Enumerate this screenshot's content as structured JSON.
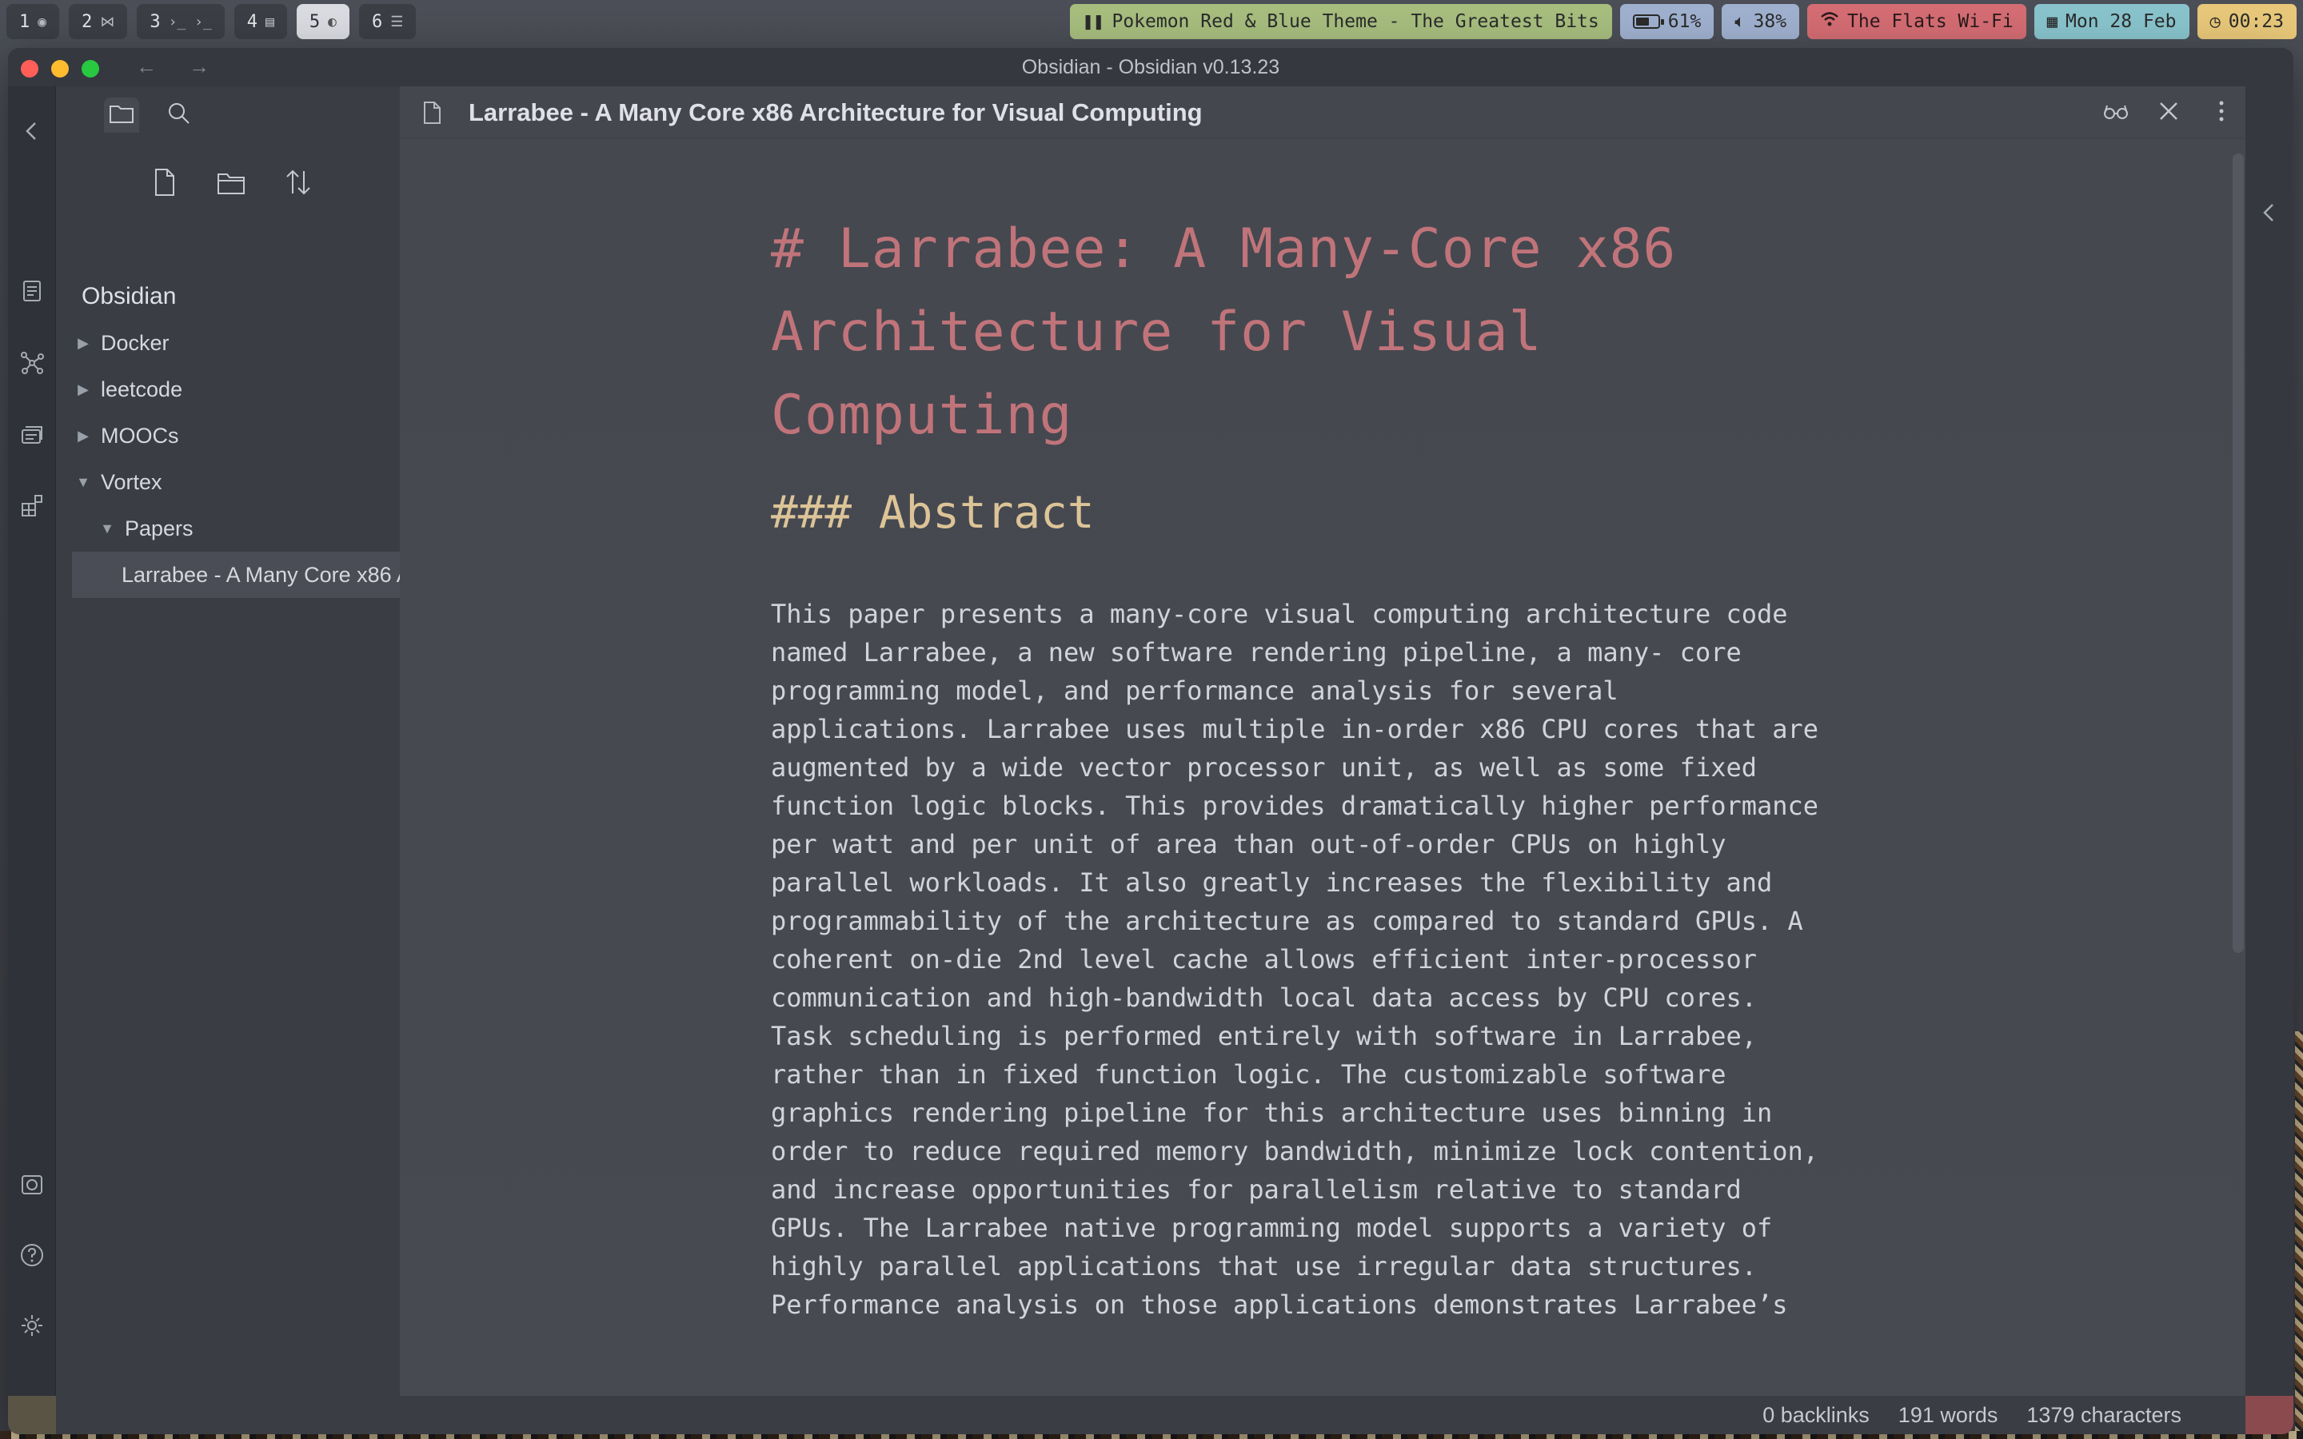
{
  "topbar": {
    "spaces": [
      {
        "num": "1",
        "glyph": "◉"
      },
      {
        "num": "2",
        "glyph": "⋈"
      },
      {
        "num": "3",
        "glyph": "›_ ›_"
      },
      {
        "num": "4",
        "glyph": "▤"
      },
      {
        "num": "5",
        "glyph": "◐"
      },
      {
        "num": "6",
        "glyph": "☰"
      }
    ],
    "active_space": "5",
    "music": {
      "icon": "pause-icon",
      "text": "Pokemon Red & Blue Theme - The Greatest Bits"
    },
    "battery": {
      "icon": "battery-icon",
      "text": "61%",
      "level": 0.61
    },
    "volume": {
      "icon": "speaker-icon",
      "text": "38%"
    },
    "wifi": {
      "icon": "wifi-icon",
      "text": "The Flats Wi-Fi"
    },
    "date": {
      "icon": "calendar-icon",
      "text": "Mon 28 Feb"
    },
    "time": {
      "icon": "clock-icon",
      "text": "00:23"
    },
    "colors": {
      "music": "#a6bd7e",
      "battery": "#9fb0cf",
      "volume": "#9fb0cf",
      "wifi": "#d36c73",
      "date": "#88c3cc",
      "time": "#e7c779"
    }
  },
  "window": {
    "title": "Obsidian - Obsidian v0.13.23"
  },
  "sidebar": {
    "vault_name": "Obsidian",
    "tree": [
      {
        "label": "Docker",
        "expanded": false,
        "depth": 0
      },
      {
        "label": "leetcode",
        "expanded": false,
        "depth": 0
      },
      {
        "label": "MOOCs",
        "expanded": false,
        "depth": 0
      },
      {
        "label": "Vortex",
        "expanded": true,
        "depth": 0
      },
      {
        "label": "Papers",
        "expanded": true,
        "depth": 1
      },
      {
        "label": "Larrabee - A Many Core x86 Architecture for Visual Computing",
        "expanded": null,
        "depth": 2,
        "selected": true
      }
    ]
  },
  "editor": {
    "tab_title": "Larrabee - A Many Core x86 Architecture for Visual Computing",
    "h1": "# Larrabee: A Many-Core x86 Architecture for Visual Computing",
    "h3": "### Abstract",
    "abstract": "This paper presents a many-core visual computing architecture code\nnamed Larrabee, a new software rendering pipeline, a many- core\nprogramming model, and performance analysis for several\napplications. Larrabee uses multiple in-order x86 CPU cores that are\naugmented by a wide vector processor unit, as well as some fixed\nfunction logic blocks. This provides dramatically higher performance\nper watt and per unit of area than out-of-order CPUs on highly\nparallel workloads. It also greatly increases the flexibility and\nprogrammability of the architecture as compared to standard GPUs. A\ncoherent on-die 2nd level cache allows efficient inter-processor\ncommunication and high-bandwidth local data access by CPU cores.\nTask scheduling is performed entirely with software in Larrabee,\nrather than in fixed function logic. The customizable software\ngraphics rendering pipeline for this architecture uses binning in\norder to reduce required memory bandwidth, minimize lock contention,\nand increase opportunities for parallelism relative to standard\nGPUs. The Larrabee native programming model supports a variety of\nhighly parallel applications that use irregular data structures.\nPerformance analysis on those applications demonstrates Larrabee’s",
    "colors": {
      "h1": "#c0747a",
      "h3": "#dcc497",
      "body": "#d2d4d9"
    }
  },
  "statusbar": {
    "backlinks": "0 backlinks",
    "words": "191 words",
    "characters": "1379 characters"
  }
}
